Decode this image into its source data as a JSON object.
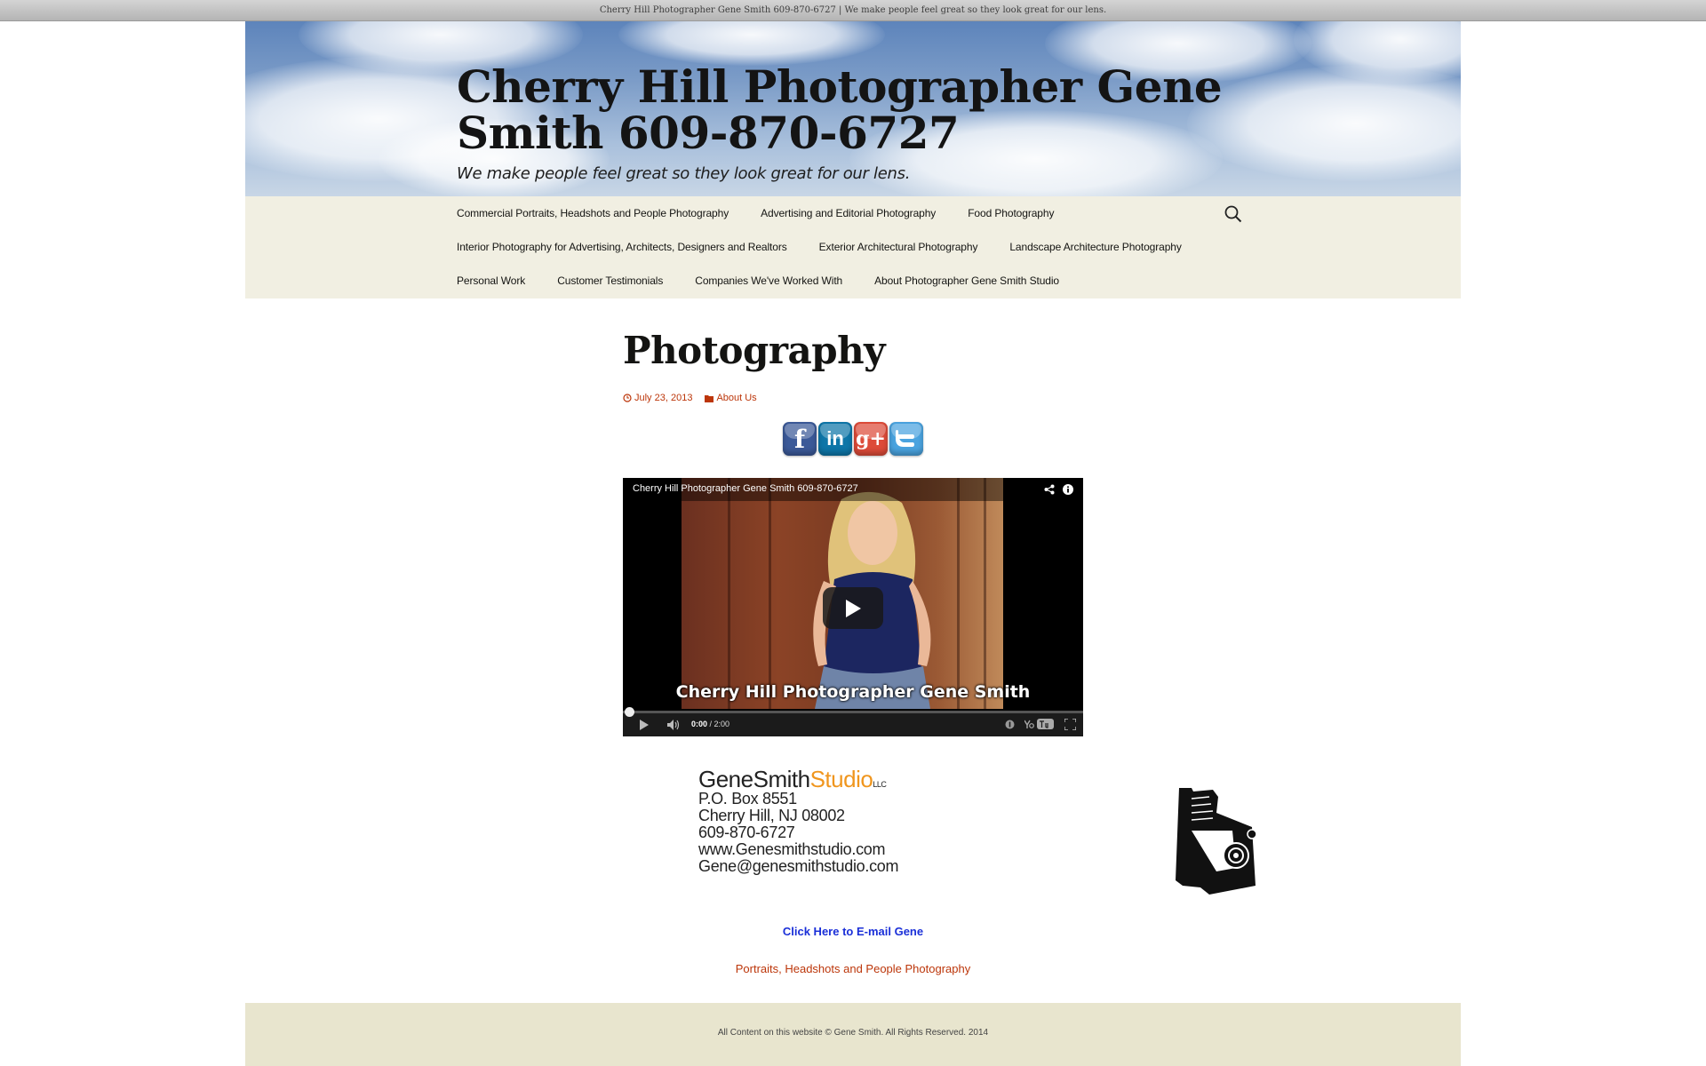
{
  "window": {
    "title": "Cherry Hill Photographer Gene Smith 609-870-6727 | We make people feel great so they look great for our lens."
  },
  "header": {
    "title": "Cherry Hill Photographer Gene Smith 609-870-6727",
    "tagline": "We make people feel great so they look great for our lens."
  },
  "nav": {
    "rows": [
      [
        "Commercial Portraits, Headshots and People Photography",
        "Advertising and Editorial Photography",
        "Food Photography"
      ],
      [
        "Interior Photography for Advertising, Architects, Designers and Realtors",
        "Exterior Architectural Photography",
        "Landscape Architecture Photography"
      ],
      [
        "Personal Work",
        "Customer Testimonials",
        "Companies We've Worked With",
        "About Photographer Gene Smith Studio"
      ]
    ],
    "search_icon": "search-icon"
  },
  "post": {
    "title": "Photography",
    "date": "July 23, 2013",
    "category": "About Us"
  },
  "social": {
    "icons": [
      "facebook-icon",
      "linkedin-icon",
      "google-plus-icon",
      "twitter-icon"
    ],
    "colors": {
      "facebook": "#3b5998",
      "linkedin": "#0e76a8",
      "google_plus": "#dd4b39",
      "twitter": "#4aa3df"
    }
  },
  "video": {
    "title": "Cherry Hill Photographer Gene Smith 609-870-6727",
    "caption": "Cherry Hill Photographer Gene Smith",
    "time_current": "0:00",
    "time_total": "/ 2:00",
    "progress": 0
  },
  "studio": {
    "name_part1": "GeneSmith",
    "name_part2": "Studio",
    "llc": "LLC",
    "address_lines": [
      "P.O. Box 8551",
      "Cherry Hill, NJ 08002",
      "609-870-6727",
      "www.Genesmithstudio.com",
      "Gene@genesmithstudio.com"
    ]
  },
  "links": {
    "email": "Click Here to E-mail Gene",
    "portraits": "Portraits, Headshots and People Photography"
  },
  "footer": {
    "text": "All Content on this website © Gene Smith. All Rights Reserved. 2014"
  },
  "colors": {
    "accent": "#bc360a",
    "nav_bg": "#f1efe2",
    "footer_bg": "#e8e5ce",
    "email_link": "#1a2fd8"
  }
}
